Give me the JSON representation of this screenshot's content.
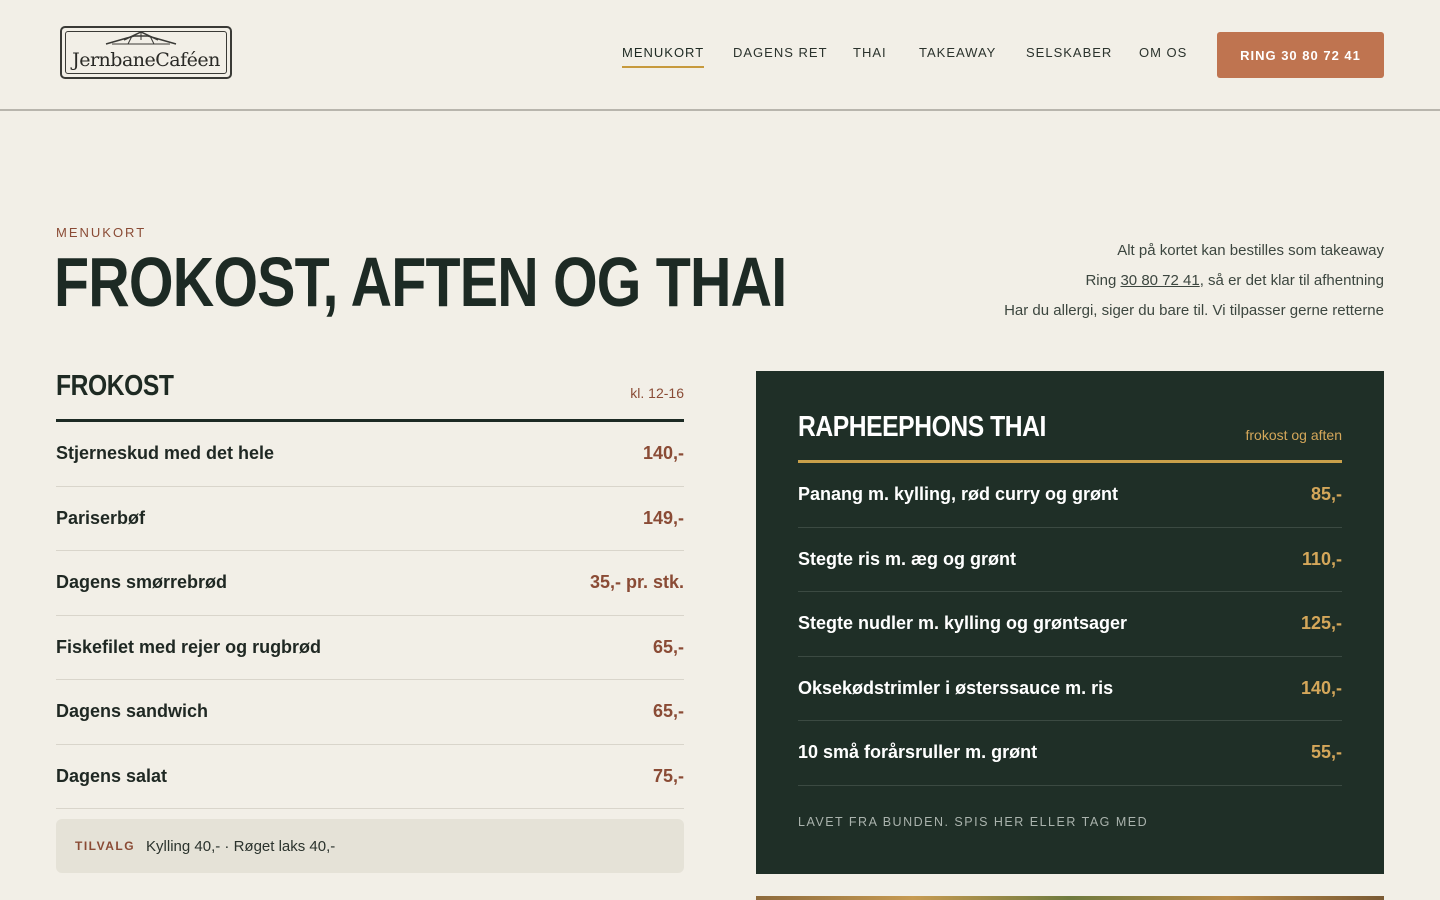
{
  "header": {
    "logo_text": "JernbaneCaféen",
    "nav": [
      {
        "label": "MENUKORT",
        "active": true
      },
      {
        "label": "DAGENS RET"
      },
      {
        "label": "THAI"
      },
      {
        "label": "TAKEAWAY"
      },
      {
        "label": "SELSKABER"
      },
      {
        "label": "OM OS"
      }
    ],
    "call_button": "RING 30 80 72 41"
  },
  "hero": {
    "eyebrow": "MENUKORT",
    "title": "FROKOST, AFTEN OG THAI",
    "info_line1": "Alt på kortet kan bestilles som takeaway",
    "info_line2_prefix": "Ring ",
    "info_phone": "30 80 72 41",
    "info_line2_suffix": ", så er det klar til afhentning",
    "info_line3": "Har du allergi, siger du bare til. Vi tilpasser gerne retterne"
  },
  "frokost": {
    "title": "FROKOST",
    "time": "kl. 12-16",
    "items": [
      {
        "name": "Stjerneskud med det hele",
        "price": "140,-"
      },
      {
        "name": "Pariserbøf",
        "price": "149,-"
      },
      {
        "name": "Dagens smørrebrød",
        "price": "35,- pr. stk."
      },
      {
        "name": "Fiskefilet med rejer og rugbrød",
        "price": "65,-"
      },
      {
        "name": "Dagens sandwich",
        "price": "65,-"
      },
      {
        "name": "Dagens salat",
        "price": "75,-"
      }
    ],
    "tilvalg_label": "TILVALG",
    "tilvalg_text": "Kylling 40,- · Røget laks 40,-"
  },
  "thai": {
    "title": "RAPHEEPHONS THAI",
    "time": "frokost og aften",
    "items": [
      {
        "name": "Panang m. kylling, rød curry og grønt",
        "price": "85,-"
      },
      {
        "name": "Stegte ris m. æg og grønt",
        "price": "110,-"
      },
      {
        "name": "Stegte nudler m. kylling og grøntsager",
        "price": "125,-"
      },
      {
        "name": "Oksekødstrimler i østerssauce m. ris",
        "price": "140,-"
      },
      {
        "name": "10 små forårsruller m. grønt",
        "price": "55,-"
      }
    ],
    "footer": "LAVET FRA BUNDEN. SPIS HER ELLER TAG MED"
  }
}
